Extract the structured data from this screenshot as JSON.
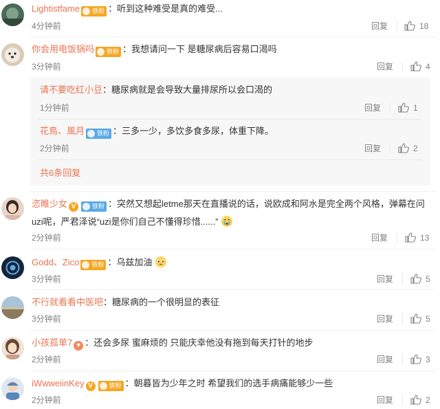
{
  "comments": [
    {
      "user": "Lightistfame",
      "badge": "铁粉",
      "text": "：听到这种难受是真的难受...",
      "time": "4分钟前",
      "reply": "回复",
      "likes": "18"
    },
    {
      "user": "你会用电饭锅吗",
      "badge": "铁粉",
      "text": "：我想请问一下 是糖尿病后容易口渴吗",
      "time": "3分钟前",
      "reply": "回复",
      "likes": "4",
      "sub": [
        {
          "user": "请不要吃红小豆",
          "text": "：糖尿病就是会导致大量排尿所以会口渴的",
          "time": "1分钟前",
          "reply": "回复",
          "likes": "1"
        },
        {
          "user": "花鳥、風月",
          "badge": "铁粉",
          "text": "：三多一少，多饮多食多尿，体重下降。",
          "time": "2分钟前",
          "reply": "回复",
          "likes": "2"
        }
      ],
      "more": "共6条回复"
    },
    {
      "user": "恣睢少女",
      "vip": "V",
      "badge": "铁粉",
      "text1": "：突然又想起letme那天在直播说的话，说欧成和阿水是完全两个风格，弹幕在问",
      "text2": "uzi呢，严君泽说“uzi是你们自己不懂得珍惜......”",
      "time": "2分钟前",
      "reply": "回复",
      "likes": "13"
    },
    {
      "user": "Godd、Zico",
      "badge": "铁粉",
      "text": "：乌兹加油",
      "time": "3分钟前",
      "reply": "回复",
      "likes": "5"
    },
    {
      "user": "不行就看看中医吧",
      "text": "：糖尿病的一个很明显的表征",
      "time": "3分钟前",
      "reply": "回复",
      "likes": "5"
    },
    {
      "user": "小孩孤单7",
      "text": "：还会多尿 蜜麻烦的 只能庆幸他没有拖到每天打针的地步",
      "time": "2分钟前",
      "reply": "回复",
      "likes": "3"
    },
    {
      "user": "iWwweiinKey",
      "vip": "V",
      "badge": "铁粉",
      "text": "：朝暮皆为少年之时 希望我们的选手病痛能够少一些",
      "time": "2分钟前",
      "reply": "回复",
      "likes": "2"
    }
  ],
  "colors": {
    "username": "#eb7350",
    "text": "#333333",
    "meta": "#808080",
    "iron_badge": "#f5a623"
  }
}
